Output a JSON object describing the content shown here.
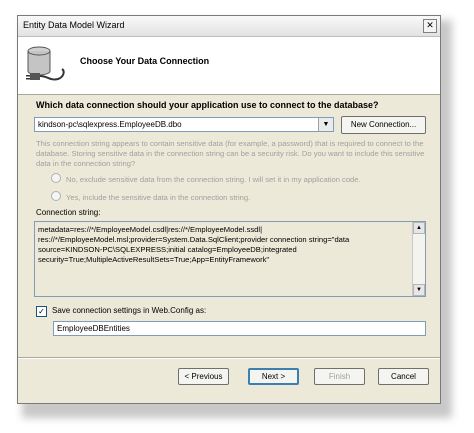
{
  "window": {
    "title": "Entity Data Model Wizard",
    "close_glyph": "✕"
  },
  "header": {
    "title": "Choose Your Data Connection",
    "icon": "database-plug-icon"
  },
  "connection": {
    "question": "Which data connection should your application use to connect to the database?",
    "selected": "kindson-pc\\sqlexpress.EmployeeDB.dbo",
    "new_connection_label": "New Connection..."
  },
  "sensitive": {
    "info": "This connection string appears to contain sensitive data (for example, a password) that is required to connect to the database. Storing sensitive data in the connection string can be a security risk. Do you want to include this sensitive data in the connection string?",
    "option_no": "No, exclude sensitive data from the connection string. I will set it in my application code.",
    "option_yes": "Yes, include the sensitive data in the connection string."
  },
  "connection_string": {
    "label": "Connection string:",
    "value": "metadata=res://*/EmployeeModel.csdl|res://*/EmployeeModel.ssdl|\nres://*/EmployeeModel.msl;provider=System.Data.SqlClient;provider connection string=\"data\nsource=KINDSON-PC\\SQLEXPRESS;initial catalog=EmployeeDB;integrated\nsecurity=True;MultipleActiveResultSets=True;App=EntityFramework\""
  },
  "save_settings": {
    "checked": true,
    "label": "Save connection settings in Web.Config as:",
    "name_value": "EmployeeDBEntities"
  },
  "footer": {
    "previous_label": "< Previous",
    "next_label": "Next >",
    "finish_label": "Finish",
    "cancel_label": "Cancel"
  }
}
